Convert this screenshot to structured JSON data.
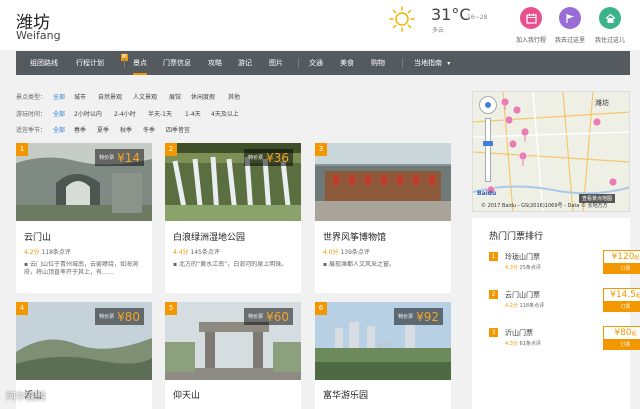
{
  "header": {
    "city": "潍坊",
    "city_en": "Weifang",
    "temperature": "31°C",
    "temp_range": "16~28",
    "weather": "多云",
    "buttons": [
      {
        "label": "加入我行程",
        "color": "#e94f8f",
        "icon": "calendar-icon"
      },
      {
        "label": "我去过这里",
        "color": "#9a6cd6",
        "icon": "flag-icon"
      },
      {
        "label": "我住过这儿",
        "color": "#3cb38a",
        "icon": "home-icon"
      }
    ]
  },
  "nav": {
    "items": [
      "组团路线",
      "行程计划",
      "景点",
      "门票信息",
      "攻略",
      "游记",
      "图片",
      "交通",
      "美食",
      "购物",
      "当地指南"
    ],
    "active": "景点",
    "new_badge": "新"
  },
  "filters": {
    "rows": [
      {
        "label": "景点类型：",
        "options": [
          "全部",
          "城市",
          "自然景观",
          "人文景观",
          "展馆",
          "休闲度假",
          "其他"
        ]
      },
      {
        "label": "游玩时间：",
        "options": [
          "全部",
          "2小时以内",
          "2-4小时",
          "半天-1天",
          "1-4天",
          "4天及以上"
        ]
      },
      {
        "label": "适宜季节：",
        "options": [
          "全部",
          "春季",
          "夏季",
          "秋季",
          "冬季",
          "四季皆宜"
        ]
      }
    ]
  },
  "cards": [
    {
      "num": "1",
      "name": "云门山",
      "score": "4.2分",
      "reviews": "118条点评",
      "price_label": "特价票",
      "price": "¥14",
      "desc_lines": [
        "云门山位于青州城南，云雾缭绕，如海洞",
        "府，将山顶直率开于其上，有……"
      ]
    },
    {
      "num": "2",
      "name": "白浪绿洲湿地公园",
      "score": "4.4分",
      "reviews": "145条点评",
      "price_label": "特价票",
      "price": "¥36",
      "desc_lines": [
        "北方的“黄水江南”，白浪河的泉上明珠。"
      ]
    },
    {
      "num": "3",
      "name": "世界风筝博物馆",
      "score": "4.0分",
      "reviews": "139条点评",
      "price_label": "",
      "price": "",
      "desc_lines": [
        "展现潍都人文风采之窗。"
      ]
    },
    {
      "num": "4",
      "name": "沂山",
      "score": "",
      "reviews": "",
      "price_label": "特价票",
      "price": "¥80",
      "desc_lines": []
    },
    {
      "num": "5",
      "name": "仰天山",
      "score": "",
      "reviews": "",
      "price_label": "特价票",
      "price": "¥60",
      "desc_lines": []
    },
    {
      "num": "6",
      "name": "富华游乐园",
      "score": "",
      "reviews": "",
      "price_label": "特价票",
      "price": "¥92",
      "desc_lines": []
    }
  ],
  "map": {
    "city_label": "潍坊",
    "copyright": "© 2017 Baidu - GS(2016)1069号 - Data © 长地万方",
    "view_button": "查看景点地图"
  },
  "ranking": {
    "title": "热门门票排行",
    "items": [
      {
        "num": "1",
        "name": "玲珑山门票",
        "score": "4.3分",
        "reviews": "25条点评",
        "price": "¥120",
        "unit": "起",
        "book": "订票"
      },
      {
        "num": "2",
        "name": "云门山门票",
        "score": "4.2分",
        "reviews": "118条点评",
        "price": "¥14.5",
        "unit": "起",
        "book": "订票"
      },
      {
        "num": "3",
        "name": "沂山门票",
        "score": "4.3分",
        "reviews": "61条点评",
        "price": "¥80",
        "unit": "起",
        "book": "订票"
      }
    ]
  },
  "watermark": "阿尔图腾"
}
